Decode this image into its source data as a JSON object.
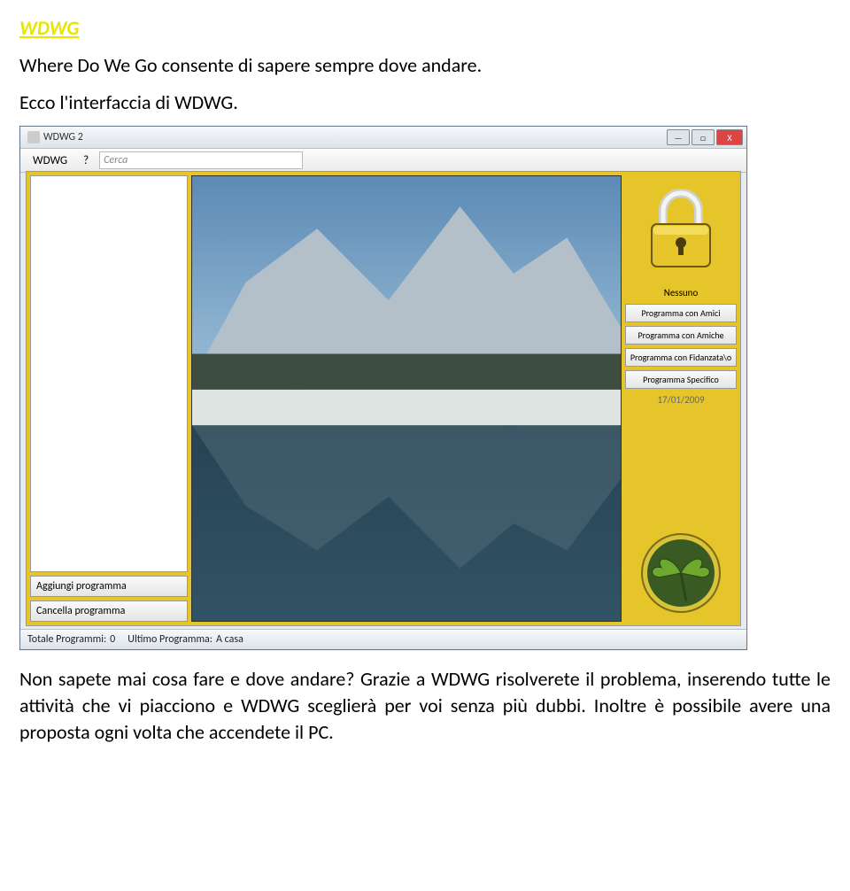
{
  "doc": {
    "title": "WDWG",
    "intro1": "Where Do We Go consente di sapere sempre dove andare.",
    "intro2": "Ecco l'interfaccia di WDWG.",
    "outro": "Non sapete mai cosa fare e dove andare? Grazie a WDWG risolverete il problema, inserendo tutte le attività che vi piacciono e WDWG sceglierà per voi senza più dubbi. Inoltre è possibile avere una proposta ogni volta che accendete il PC."
  },
  "app": {
    "title": "WDWG 2",
    "menu": {
      "wdwg": "WDWG",
      "help": "?",
      "search_placeholder": "Cerca"
    },
    "left_buttons": {
      "add": "Aggiungi programma",
      "del": "Cancella programma"
    },
    "right": {
      "nessuno": "Nessuno",
      "btn1": "Programma con Amici",
      "btn2": "Programma con Amiche",
      "btn3": "Programma con Fidanzata\\o",
      "btn4": "Programma Specifico",
      "date": "17/01/2009"
    },
    "status": {
      "totale_lbl": "Totale Programmi:",
      "totale_val": "0",
      "ultimo_lbl": "Ultimo Programma:",
      "ultimo_val": "A casa"
    }
  }
}
